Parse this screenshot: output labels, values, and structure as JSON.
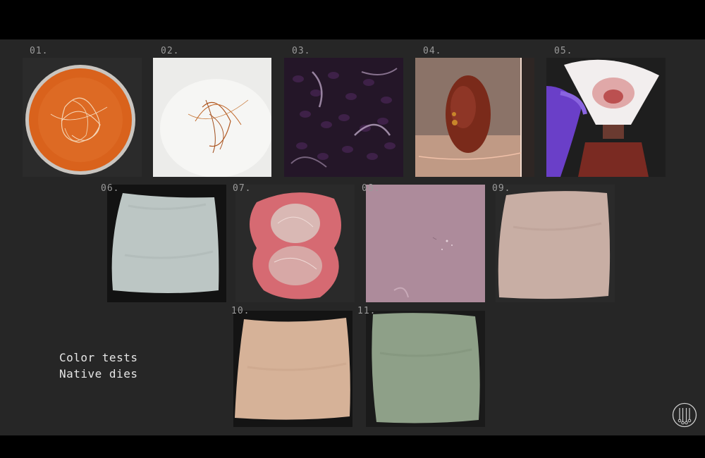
{
  "labels": {
    "n01": "01.",
    "n02": "02.",
    "n03": "03.",
    "n04": "04.",
    "n05": "05.",
    "n06": "06.",
    "n07": "07.",
    "n08": "08.",
    "n09": "09.",
    "n10": "10.",
    "n11": "11."
  },
  "caption": {
    "line1": "Color tests",
    "line2": "Native dies"
  },
  "colors": {
    "background": "#262626",
    "label": "#9a9a9a",
    "caption": "#e6e6e6"
  }
}
